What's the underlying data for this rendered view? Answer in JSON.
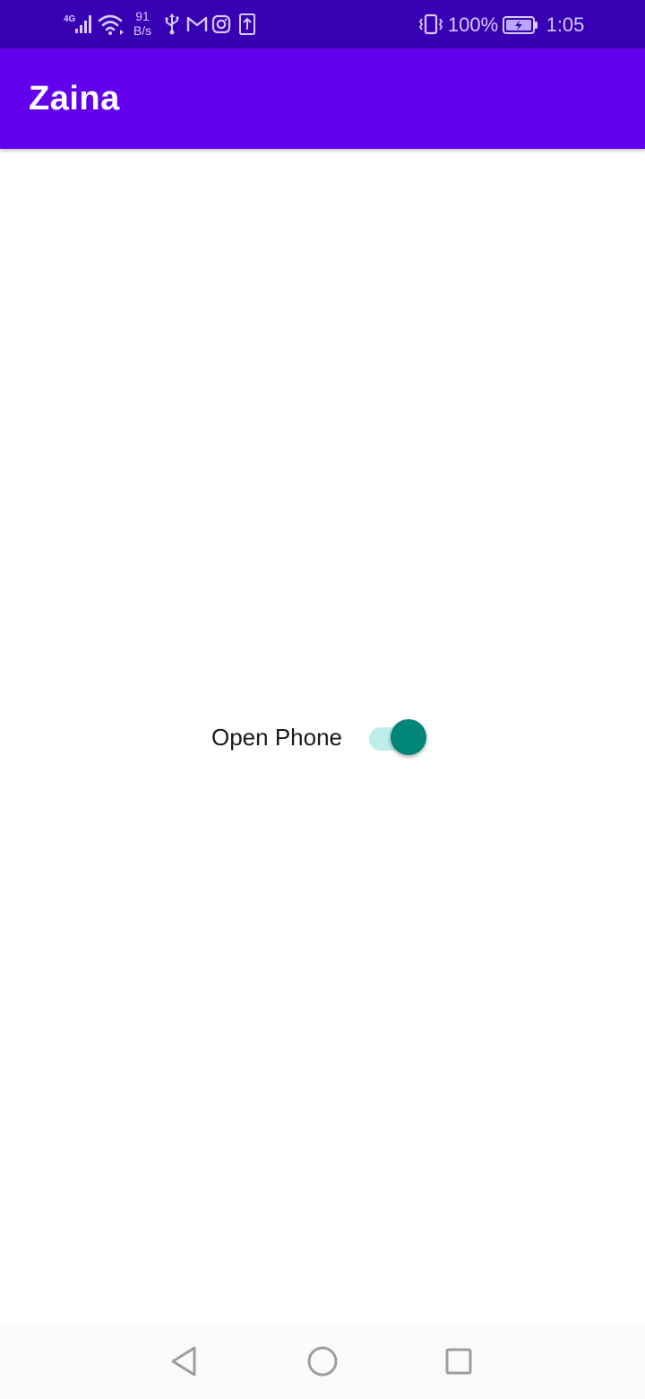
{
  "status_bar": {
    "network_type": "4G",
    "net_speed_value": "91",
    "net_speed_unit": "B/s",
    "battery_percent": "100%",
    "time": "1:05",
    "icons": [
      "signal-icon",
      "wifi-icon",
      "usb-icon",
      "gmail-icon",
      "instagram-icon",
      "upload-icon",
      "vibrate-icon",
      "battery-charging-icon"
    ]
  },
  "app_bar": {
    "title": "Zaina"
  },
  "main": {
    "switch_label": "Open Phone",
    "switch_on": true
  },
  "nav_bar": {
    "icons": [
      "back-icon",
      "home-icon",
      "recents-icon"
    ]
  },
  "colors": {
    "status_bar": "#3700b3",
    "app_bar": "#6200ee",
    "switch_thumb": "#018577",
    "switch_track": "#bdeeea",
    "nav_bar": "#fafafa"
  }
}
